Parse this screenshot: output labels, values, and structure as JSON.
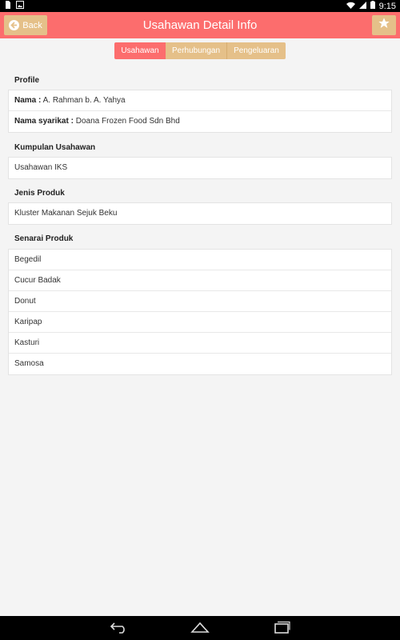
{
  "status_bar": {
    "time": "9:15"
  },
  "header": {
    "back_label": "Back",
    "title": "Usahawan Detail Info"
  },
  "tabs": [
    {
      "label": "Usahawan",
      "active": true
    },
    {
      "label": "Perhubungan",
      "active": false
    },
    {
      "label": "Pengeluaran",
      "active": false
    }
  ],
  "profile": {
    "heading": "Profile",
    "nama_label": "Nama :",
    "nama_value": "A. Rahman b. A. Yahya",
    "syarikat_label": "Nama syarikat :",
    "syarikat_value": "Doana Frozen Food Sdn Bhd"
  },
  "kumpulan": {
    "heading": "Kumpulan Usahawan",
    "value": "Usahawan IKS"
  },
  "jenis": {
    "heading": "Jenis Produk",
    "value": "Kluster Makanan Sejuk Beku"
  },
  "senarai": {
    "heading": "Senarai Produk",
    "items": [
      "Begedil",
      "Cucur Badak",
      "Donut",
      "Karipap",
      "Kasturi",
      "Samosa"
    ]
  },
  "colors": {
    "primary": "#fc6d6d",
    "accent": "#e5c089",
    "background": "#f4f4f4"
  }
}
